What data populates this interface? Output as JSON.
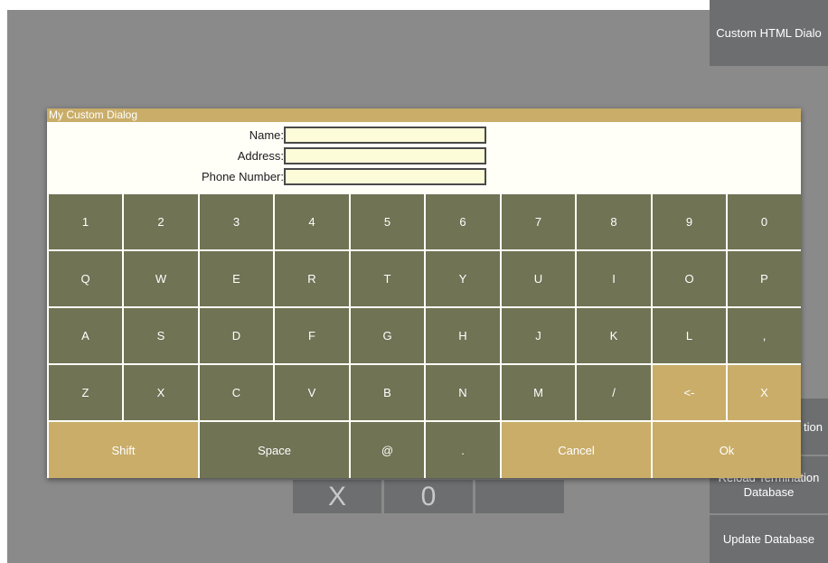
{
  "side_buttons": {
    "custom_html_dialog": "Custom HTML Dialo",
    "partial_option": "tion",
    "reload_label_line1": "Reload Termination",
    "reload_label_line2": "Database",
    "update_database": "Update Database"
  },
  "background_keys": [
    "X",
    "0",
    ""
  ],
  "dialog": {
    "title": "My Custom Dialog",
    "fields": [
      {
        "label": "Name:",
        "value": ""
      },
      {
        "label": "Address:",
        "value": ""
      },
      {
        "label": "Phone Number:",
        "value": ""
      }
    ]
  },
  "keyboard": {
    "row1": [
      "1",
      "2",
      "3",
      "4",
      "5",
      "6",
      "7",
      "8",
      "9",
      "0"
    ],
    "row2": [
      "Q",
      "W",
      "E",
      "R",
      "T",
      "Y",
      "U",
      "I",
      "O",
      "P"
    ],
    "row3": [
      "A",
      "S",
      "D",
      "F",
      "G",
      "H",
      "J",
      "K",
      "L",
      ","
    ],
    "row4": [
      "Z",
      "X",
      "C",
      "V",
      "B",
      "N",
      "M",
      "/",
      "<-",
      "X"
    ],
    "row5": [
      "Shift",
      "Space",
      "@",
      ".",
      "Cancel",
      "Ok"
    ]
  },
  "colors": {
    "key_dark": "#707354",
    "key_gold": "#c9ad69",
    "input_bg": "#fdfcd9",
    "backdrop": "#8a8a8a",
    "side_button": "#6d6e70"
  }
}
